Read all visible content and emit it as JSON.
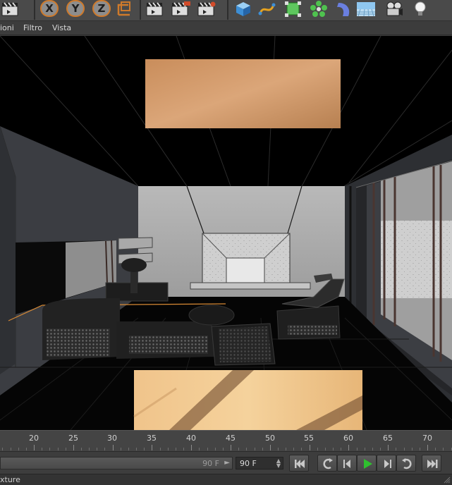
{
  "menubar": {
    "items": [
      "ioni",
      "Filtro",
      "Vista"
    ]
  },
  "toolbar": {
    "axis_x": "X",
    "axis_y": "Y",
    "axis_z": "Z",
    "icons": [
      "render-region-icon",
      "axis-x-lock",
      "axis-y-lock",
      "axis-z-lock",
      "world-coordinates-icon",
      "render-view-icon",
      "render-picture-viewer-icon",
      "render-settings-icon",
      "cube-primitive-icon",
      "spline-pen-icon",
      "subdivision-icon",
      "cloner-icon",
      "deformer-icon",
      "floor-scene-icon",
      "camera-icon",
      "light-icon"
    ]
  },
  "timeline": {
    "ruler_labels": [
      "20",
      "25",
      "30",
      "35",
      "40",
      "45",
      "50",
      "55",
      "60",
      "65",
      "70"
    ]
  },
  "playback": {
    "end_frame_slider": "90 F",
    "end_frame_field": "90 F"
  },
  "status": {
    "text": "xture"
  },
  "colors": {
    "accent": "#cf7a2b",
    "play_green": "#2fc12f",
    "ui_panel": "#3d3d3d"
  }
}
